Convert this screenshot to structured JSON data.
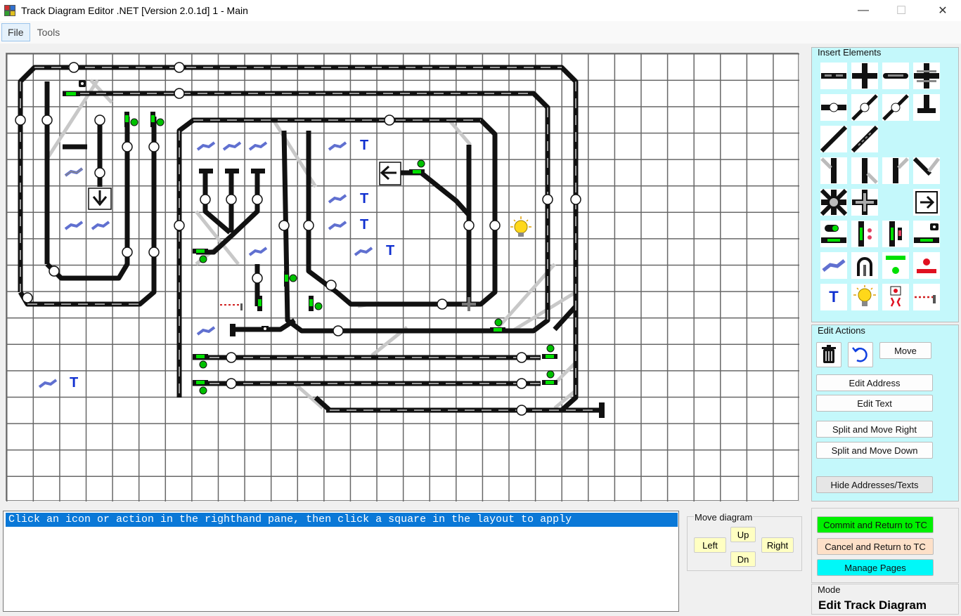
{
  "window": {
    "title": "Track Diagram Editor  .NET  [Version 2.0.1d]   1 - Main",
    "minimize_glyph": "—",
    "maximize_glyph": "☐",
    "close_glyph": "✕"
  },
  "menu": {
    "file": "File",
    "tools": "Tools"
  },
  "insert_elements": {
    "label": "Insert Elements",
    "icons": [
      "straight-track-icon",
      "cross-track-icon",
      "curve-track-icon",
      "bridge-track-icon",
      "block-detector-icon",
      "diagonal-block-icon",
      "diagonal-detector-icon",
      "buffer-stop-icon",
      "diagonal-track-icon",
      "diagonal-double-icon",
      "switch-left-icon",
      "switch-straight-icon",
      "switch-right-icon",
      "switch-diagonal-icon",
      "double-slip-icon",
      "crossing-switch-icon",
      "route-arrow-icon",
      "signal-block-icon",
      "signal-red-icon",
      "signal-green-icon",
      "decoupler-icon",
      "accessory-icon",
      "tunnel-icon",
      "green-indicator-icon",
      "red-indicator-icon",
      "text-icon",
      "lamp-icon",
      "figure-icon",
      "barrier-icon"
    ],
    "text_glyph": "T"
  },
  "edit_actions": {
    "label": "Edit Actions",
    "move": "Move",
    "edit_address": "Edit Address",
    "edit_text": "Edit Text",
    "split_right": "Split and Move Right",
    "split_down": "Split and Move Down",
    "hide_addresses": "Hide Addresses/Texts"
  },
  "status": {
    "message": "Click an icon or action in the righthand pane, then click a square in the layout to apply"
  },
  "move_diagram": {
    "label": "Move diagram",
    "up": "Up",
    "down": "Dn",
    "left": "Left",
    "right": "Right"
  },
  "commands": {
    "commit": "Commit and Return to TC",
    "cancel": "Cancel and Return to TC",
    "manage": "Manage Pages"
  },
  "mode": {
    "label": "Mode",
    "value": "Edit Track Diagram"
  },
  "diagram": {
    "text_glyph": "T"
  },
  "colors": {
    "track": "#111111",
    "ghost_track": "#c8c8c8",
    "panel_bg": "#c4f8fb",
    "selection": "#0a78d7",
    "commit": "#00f000",
    "cancel": "#fde0c8",
    "manage": "#00f8f8",
    "move_buttons": "#ffffc2",
    "text_blue": "#1030d0"
  }
}
